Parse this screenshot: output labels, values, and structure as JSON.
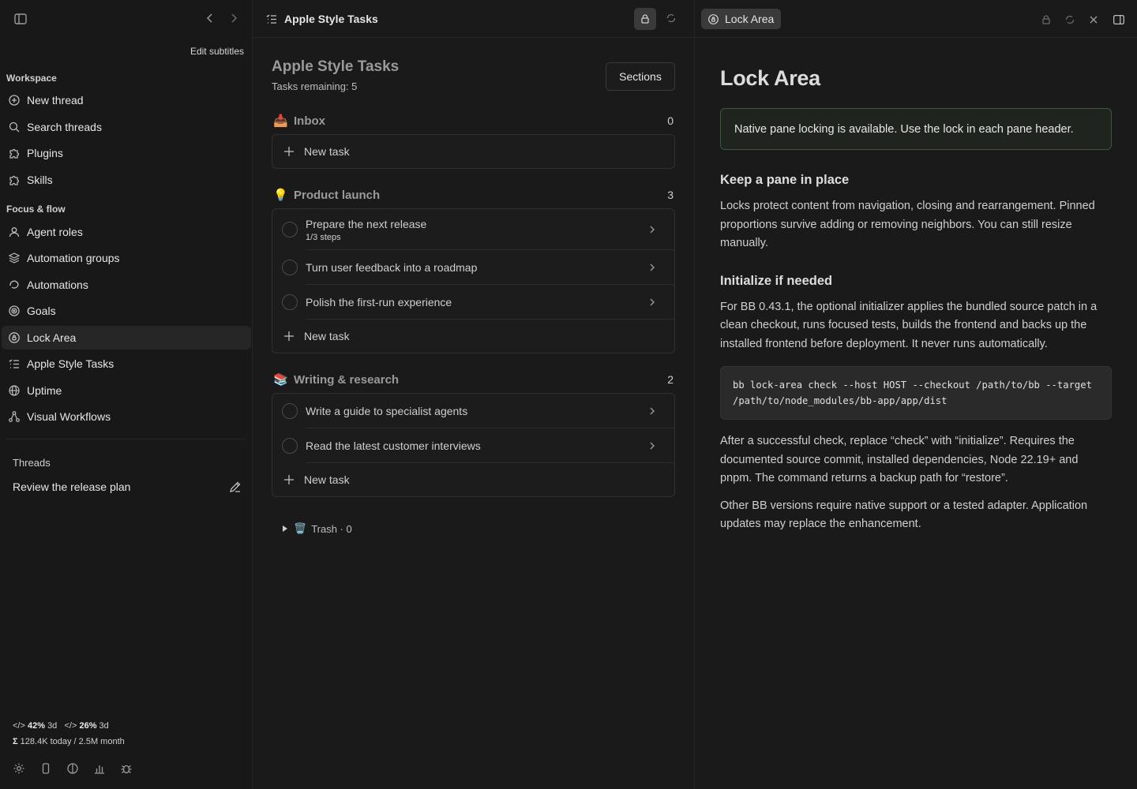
{
  "sidebar": {
    "edit_subtitles": "Edit subtitles",
    "workspace_label": "Workspace",
    "workspace_items": [
      {
        "label": "New thread",
        "icon": "plus-circle-icon"
      },
      {
        "label": "Search threads",
        "icon": "search-icon"
      },
      {
        "label": "Plugins",
        "icon": "puzzle-icon"
      },
      {
        "label": "Skills",
        "icon": "puzzle-icon"
      }
    ],
    "focus_label": "Focus & flow",
    "focus_items": [
      {
        "label": "Agent roles",
        "icon": "person-icon"
      },
      {
        "label": "Automation groups",
        "icon": "layers-icon"
      },
      {
        "label": "Automations",
        "icon": "loop-icon"
      },
      {
        "label": "Goals",
        "icon": "target-icon"
      },
      {
        "label": "Lock Area",
        "icon": "lock-circle-icon",
        "active": true
      },
      {
        "label": "Apple Style Tasks",
        "icon": "checklist-icon"
      },
      {
        "label": "Uptime",
        "icon": "globe-icon"
      },
      {
        "label": "Visual Workflows",
        "icon": "workflow-icon"
      }
    ],
    "threads_label": "Threads",
    "threads": [
      {
        "label": "Review the release plan"
      }
    ],
    "usage": {
      "a_pct": "42%",
      "a_period": "3d",
      "b_pct": "26%",
      "b_period": "3d",
      "sigma": "Σ",
      "tokens": "128.4K today / 2.5M month"
    }
  },
  "tasks_pane": {
    "header_title": "Apple Style Tasks",
    "title": "Apple Style Tasks",
    "remaining": "Tasks remaining: 5",
    "sections_button": "Sections",
    "new_task": "New task",
    "groups": [
      {
        "emoji": "📥",
        "name": "Inbox",
        "count": "0",
        "tasks": []
      },
      {
        "emoji": "💡",
        "name": "Product launch",
        "count": "3",
        "tasks": [
          {
            "label": "Prepare the next release",
            "sub": "1/3 steps"
          },
          {
            "label": "Turn user feedback into a roadmap"
          },
          {
            "label": "Polish the first-run experience"
          }
        ]
      },
      {
        "emoji": "📚",
        "name": "Writing & research",
        "count": "2",
        "tasks": [
          {
            "label": "Write a guide to specialist agents"
          },
          {
            "label": "Read the latest customer interviews"
          }
        ]
      }
    ],
    "trash": "Trash · 0",
    "trash_emoji": "🗑️"
  },
  "doc_pane": {
    "tab_label": "Lock Area",
    "title": "Lock Area",
    "callout": "Native pane locking is available. Use the lock in each pane header.",
    "h2_keep": "Keep a pane in place",
    "p_keep": "Locks protect content from navigation, closing and rearrangement. Pinned proportions survive adding or removing neighbors. You can still resize manually.",
    "h2_init": "Initialize if needed",
    "p_init": "For BB 0.43.1, the optional initializer applies the bundled source patch in a clean checkout, runs focused tests, builds the frontend and backs up the installed frontend before deployment. It never runs automatically.",
    "code": "bb lock-area check --host HOST --checkout /path/to/bb --target /path/to/node_modules/bb-app/app/dist",
    "p_after": "After a successful check, replace “check” with “initialize”. Requires the documented source commit, installed dependencies, Node 22.19+ and pnpm. The command returns a backup path for “restore”.",
    "p_other": "Other BB versions require native support or a tested adapter. Application updates may replace the enhancement."
  },
  "colors": {
    "background": "#1a1a1a",
    "sidebar": "#181818",
    "callout_border": "#3a5a3a",
    "active_item": "#262626"
  }
}
